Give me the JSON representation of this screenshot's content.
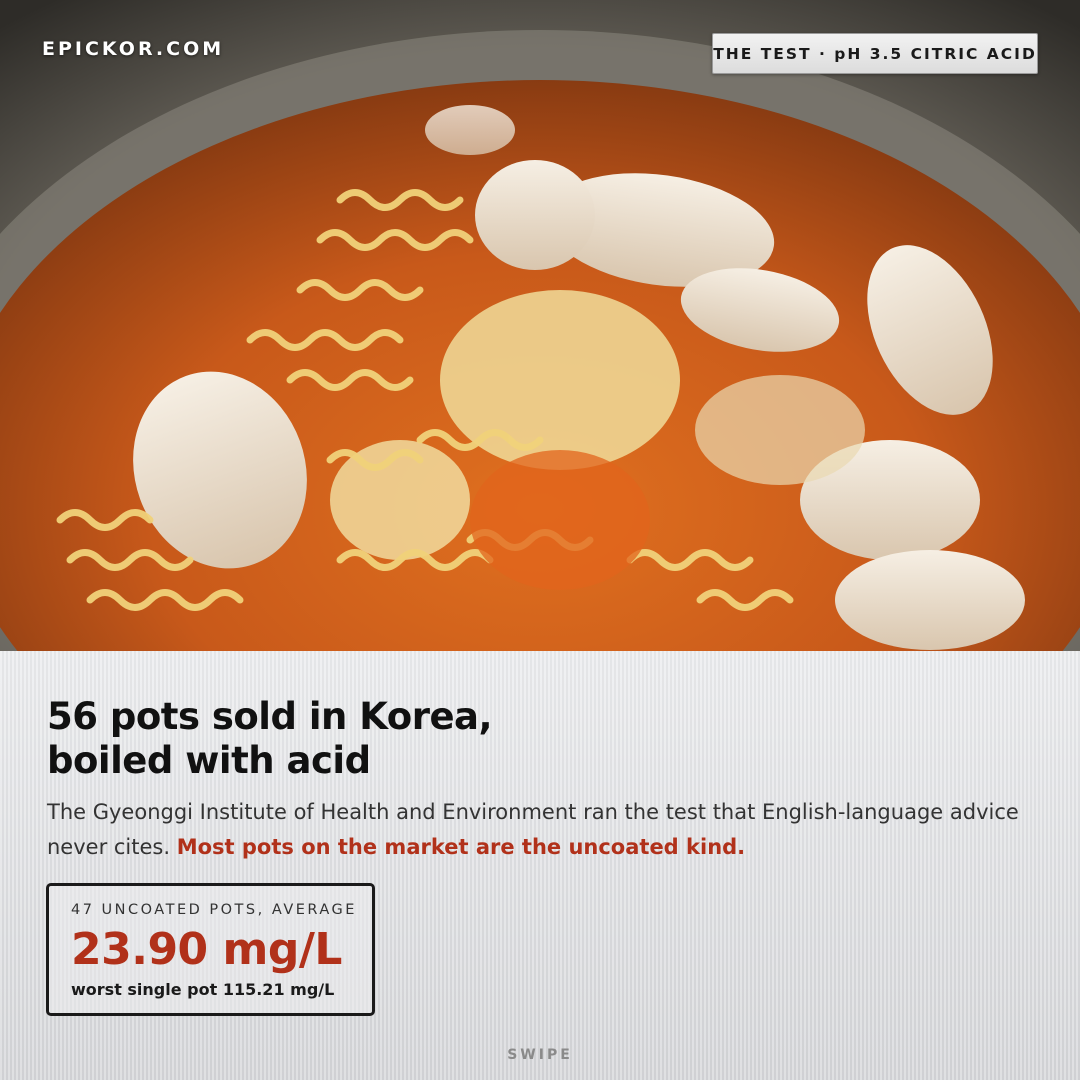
{
  "brand": {
    "name": "EPICKOR.COM"
  },
  "badge": {
    "label": "THE TEST · pH 3.5 CITRIC ACID"
  },
  "photo": {
    "subject": "ramyeon-pot-photo"
  },
  "headline": {
    "line1": "56 pots sold in Korea,",
    "line2": "boiled with acid"
  },
  "body": {
    "text": "The Gyeonggi Institute of Health and Environment ran the test that English-language advice never cites. ",
    "emphasis": "Most pots on the market are the uncoated kind."
  },
  "stat": {
    "label": "47 UNCOATED POTS, AVERAGE",
    "value": "23.90 mg/L",
    "note": "worst single pot 115.21 mg/L"
  },
  "footer": {
    "swipe": "SWIPE"
  },
  "colors": {
    "accent": "#b1311a",
    "text": "#111111",
    "panel": "#e3e4e6"
  }
}
